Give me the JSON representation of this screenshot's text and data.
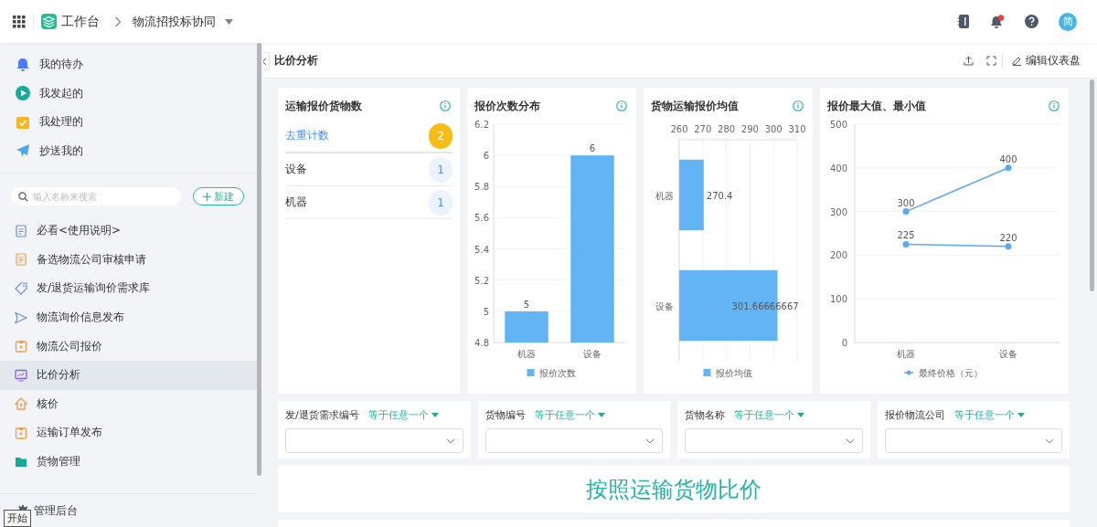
{
  "topbar": {
    "app_name": "工作台",
    "breadcrumb": "物流招投标协同",
    "avatar": "简",
    "has_notification": true
  },
  "sidebar": {
    "quick_items": [
      "我的待办",
      "我发起的",
      "我处理的",
      "抄送我的"
    ],
    "search": {
      "placeholder": "输入名称来搜索"
    },
    "new_button": "新建",
    "items": [
      {
        "label": "必看<使用说明>",
        "selected": false
      },
      {
        "label": "备选物流公司审核申请",
        "selected": false
      },
      {
        "label": "发/退货运输询价需求库",
        "selected": false
      },
      {
        "label": "物流询价信息发布",
        "selected": false
      },
      {
        "label": "物流公司报价",
        "selected": false
      },
      {
        "label": "比价分析",
        "selected": true
      },
      {
        "label": "核价",
        "selected": false
      },
      {
        "label": "运输订单发布",
        "selected": false
      },
      {
        "label": "货物管理",
        "selected": false
      }
    ],
    "footer": "管理后台"
  },
  "tooltip": "开始",
  "dashboard": {
    "title": "比价分析",
    "edit_button": "编辑仪表盘",
    "count_card": {
      "title": "运输报价货物数",
      "rows": [
        {
          "kind": "total",
          "label": "去重计数",
          "count": "2"
        },
        {
          "kind": "item",
          "label": "设备",
          "count": "1"
        },
        {
          "kind": "item",
          "label": "机器",
          "count": "1"
        }
      ]
    },
    "charts": [
      {
        "title": "报价次数分布",
        "chart_data": {
          "type": "bar",
          "categories": [
            "机器",
            "设备"
          ],
          "series": [
            {
              "name": "报价次数",
              "color": "#63b4f4",
              "values": [
                5,
                6
              ]
            }
          ],
          "grid": true,
          "ylim": [
            4.8,
            6.2
          ],
          "yticks": [
            4.8,
            5,
            5.2,
            5.4,
            5.6,
            5.8,
            6,
            6.2
          ],
          "data_labels": true
        }
      },
      {
        "title": "货物运输报价均值",
        "chart_data": {
          "type": "bar",
          "orientation": "horizontal",
          "categories": [
            "机器",
            "设备"
          ],
          "series": [
            {
              "name": "报价均值",
              "color": "#63b4f4",
              "values": [
                270.4,
                301.66666667
              ]
            }
          ],
          "grid": true,
          "xlim": [
            260,
            310
          ],
          "xticks": [
            260,
            270,
            280,
            290,
            300,
            310
          ],
          "value_labels": [
            "270.4",
            "301.66666667"
          ]
        }
      },
      {
        "title": "报价最大值、最小值",
        "chart_data": {
          "type": "line",
          "categories": [
            "机器",
            "设备"
          ],
          "series": [
            {
              "name": "最终价格（元）",
              "color": "#5aaaf0",
              "marker": true,
              "values": [
                300,
                400
              ]
            },
            {
              "color": "#5aaaf0",
              "marker": true,
              "values": [
                225,
                220
              ]
            }
          ],
          "grid": true,
          "ylim": [
            0,
            500
          ],
          "yticks": [
            0,
            100,
            200,
            300,
            400,
            500
          ],
          "data_labels": true
        }
      }
    ],
    "filters": [
      {
        "label": "发/退货需求编号",
        "operator": "等于任意一个"
      },
      {
        "label": "货物编号",
        "operator": "等于任意一个"
      },
      {
        "label": "货物名称",
        "operator": "等于任意一个"
      },
      {
        "label": "报价物流公司",
        "operator": "等于任意一个"
      }
    ],
    "banner": "按照运输货物比价"
  }
}
